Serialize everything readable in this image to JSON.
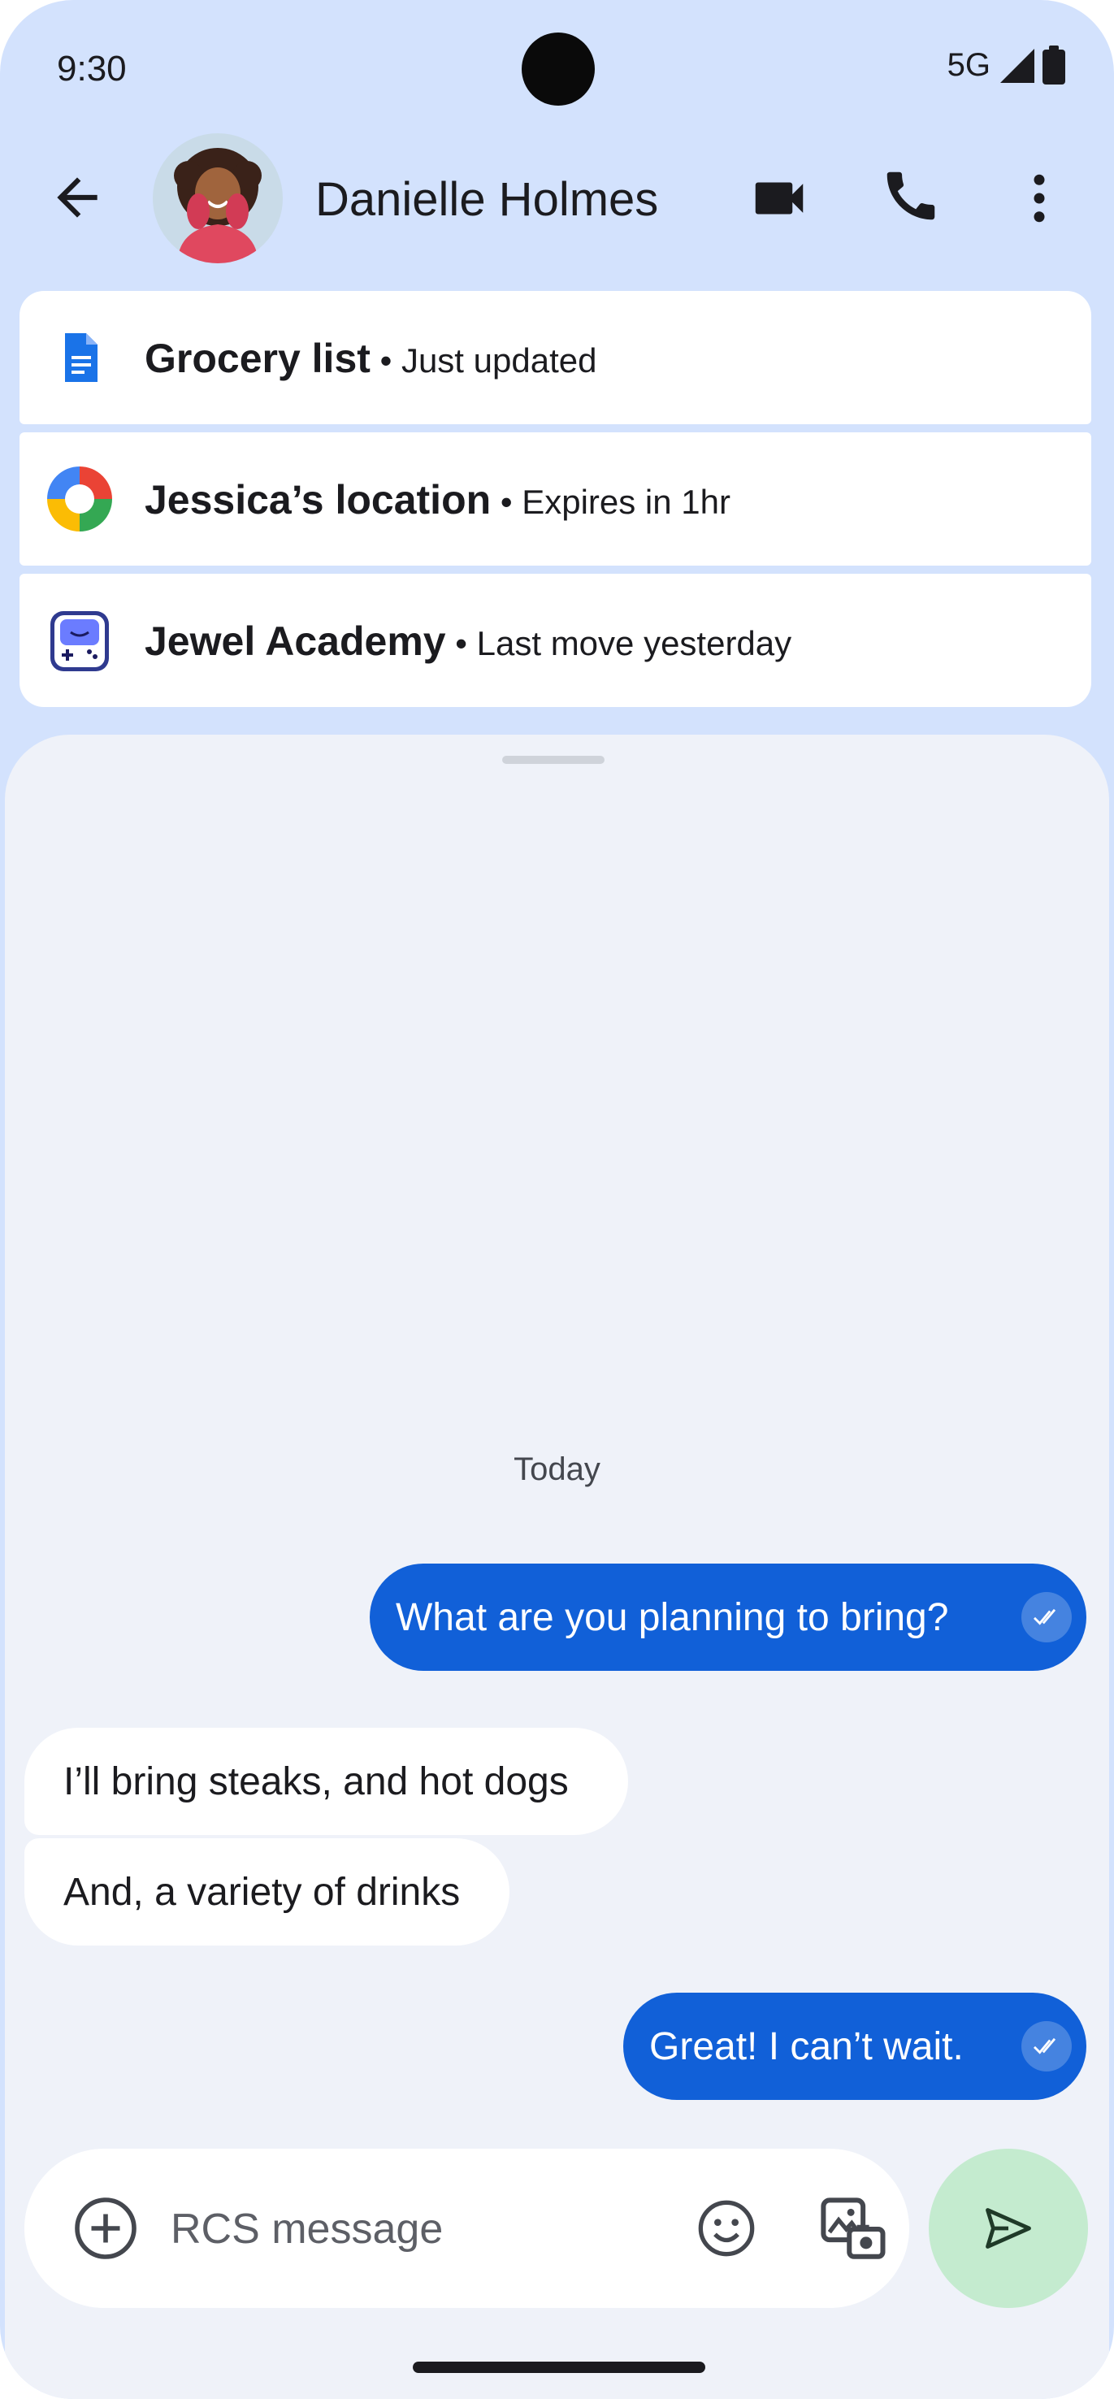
{
  "status_bar": {
    "time": "9:30",
    "network": "5G",
    "icons": [
      "signal-icon",
      "battery-icon"
    ]
  },
  "header": {
    "contact_name": "Danielle Holmes",
    "icons": [
      "back-arrow-icon",
      "video-call-icon",
      "phone-call-icon",
      "more-vert-icon"
    ]
  },
  "cards": [
    {
      "title": "Grocery list",
      "subtitle": " • Just updated",
      "icon": "document-icon",
      "icon_color": "#1a73e8"
    },
    {
      "title": "Jessica’s location",
      "subtitle": " • Expires in 1hr",
      "icon": "location-sharing-icon"
    },
    {
      "title": "Jewel Academy",
      "subtitle": " • Last move yesterday",
      "icon": "game-icon",
      "icon_color": "#3949ab"
    }
  ],
  "conversation": {
    "date_label": "Today",
    "messages": [
      {
        "direction": "outgoing",
        "text": "What are you planning to bring?",
        "status": "read"
      },
      {
        "direction": "incoming",
        "text": "I’ll bring steaks, and hot dogs"
      },
      {
        "direction": "incoming",
        "text": "And, a variety of drinks"
      },
      {
        "direction": "outgoing",
        "text": "Great! I can’t wait.",
        "status": "read"
      }
    ]
  },
  "compose": {
    "placeholder": "RCS message",
    "value": "",
    "icons": [
      "add-circle-icon",
      "emoji-icon",
      "gallery-icon",
      "send-icon"
    ]
  },
  "colors": {
    "background": "#d3e2fd",
    "sheet": "#eff2f9",
    "outgoing_bubble": "#1160d8",
    "incoming_bubble": "#ffffff",
    "send_button": "#c4ebcf"
  }
}
